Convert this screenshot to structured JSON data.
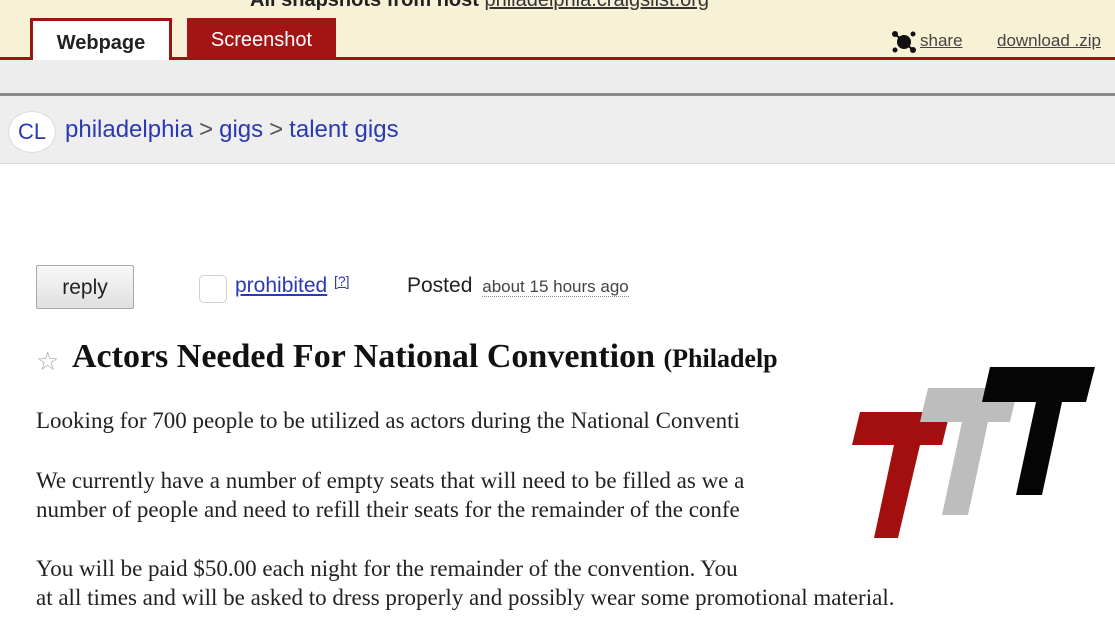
{
  "archive": {
    "title_prefix": "All snapshots from host",
    "host": "philadelphia.craigslist.org",
    "tabs": [
      {
        "label": "Webpage",
        "active": true
      },
      {
        "label": "Screenshot",
        "active": false
      }
    ],
    "share_label": "share",
    "download_label": "download .zip",
    "accent_color": "#a51414"
  },
  "craigslist": {
    "logo_text": "CL",
    "breadcrumb": [
      "philadelphia",
      "gigs",
      "talent gigs"
    ],
    "breadcrumb_sep": ">"
  },
  "post": {
    "reply_label": "reply",
    "prohibited_label": "prohibited",
    "help_marker": "[?]",
    "posted_label": "Posted",
    "posted_ago": "about 15 hours ago",
    "title": "Actors Needed For National Convention",
    "location": "(Philadelp",
    "paragraphs": [
      [
        "Looking for 700 people to be utilized as actors during the National Conventi"
      ],
      [
        "We currently have a number of empty seats that will need to be filled as we a",
        "number of people and need to refill their seats for the remainder of the confe"
      ],
      [
        "You will be paid $50.00 each night for the remainder of the convention. You",
        "at all times and will be asked to dress properly and possibly wear some promotional material."
      ]
    ]
  },
  "watermark": {
    "colors": [
      "#a30f0f",
      "#bdbdbd",
      "#050505"
    ]
  }
}
